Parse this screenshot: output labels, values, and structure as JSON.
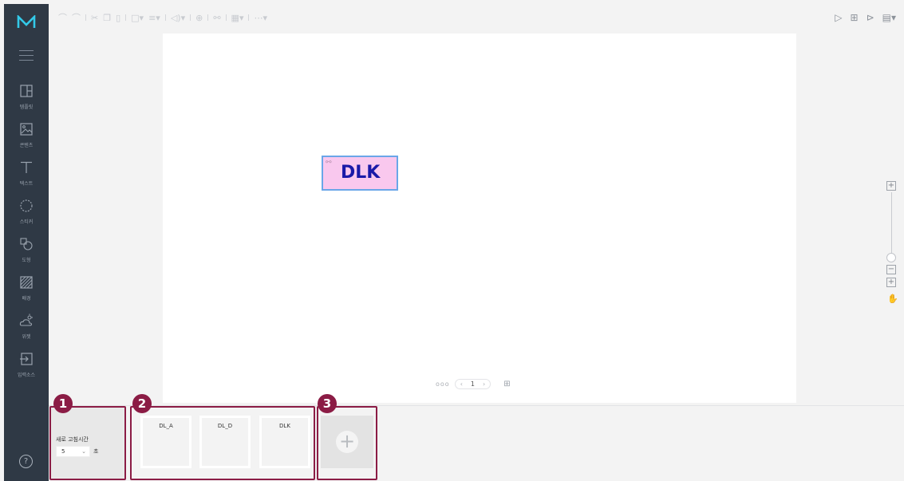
{
  "sidebar": {
    "logo": "M",
    "items": [
      {
        "label": "템플릿",
        "icon": "template-icon"
      },
      {
        "label": "콘텐츠",
        "icon": "image-icon"
      },
      {
        "label": "텍스트",
        "icon": "text-icon"
      },
      {
        "label": "스티커",
        "icon": "sticker-icon"
      },
      {
        "label": "도형",
        "icon": "shape-icon"
      },
      {
        "label": "배경",
        "icon": "background-icon"
      },
      {
        "label": "위젯",
        "icon": "weather-widget-icon"
      },
      {
        "label": "입력소스",
        "icon": "input-source-icon"
      }
    ],
    "help": "?"
  },
  "toolbar": {
    "tools": [
      "undo-icon",
      "redo-icon",
      "cut-icon",
      "copy-icon",
      "paste-icon",
      "frame-icon",
      "align-icon",
      "volume-icon",
      "web-icon",
      "link-icon",
      "grid-icon",
      "more-icon"
    ],
    "right": [
      "play-icon",
      "new-screen-icon",
      "open-folder-icon",
      "save-icon"
    ]
  },
  "canvas": {
    "element_text": "DLK"
  },
  "pager": {
    "dots": "ooo",
    "prev": "‹",
    "page": "1",
    "next": "›",
    "add_icon": "add-page-icon"
  },
  "zoom": {
    "in": "+",
    "out": "−",
    "fit": "+",
    "hand_icon": "hand-icon"
  },
  "bottom": {
    "callouts": [
      "1",
      "2",
      "3"
    ],
    "refresh": {
      "label": "새로 고침시간",
      "value": "5",
      "unit": "초"
    },
    "pages": [
      {
        "label": "DL_A"
      },
      {
        "label": "DL_D"
      },
      {
        "label": "DLK"
      }
    ],
    "add_label": "+"
  },
  "colors": {
    "sidebar_bg": "#2f3945",
    "highlight": "#8b1c45",
    "element_bg": "#f9c8ee",
    "element_border": "#6aa6e8",
    "element_text": "#1a1aa8"
  }
}
